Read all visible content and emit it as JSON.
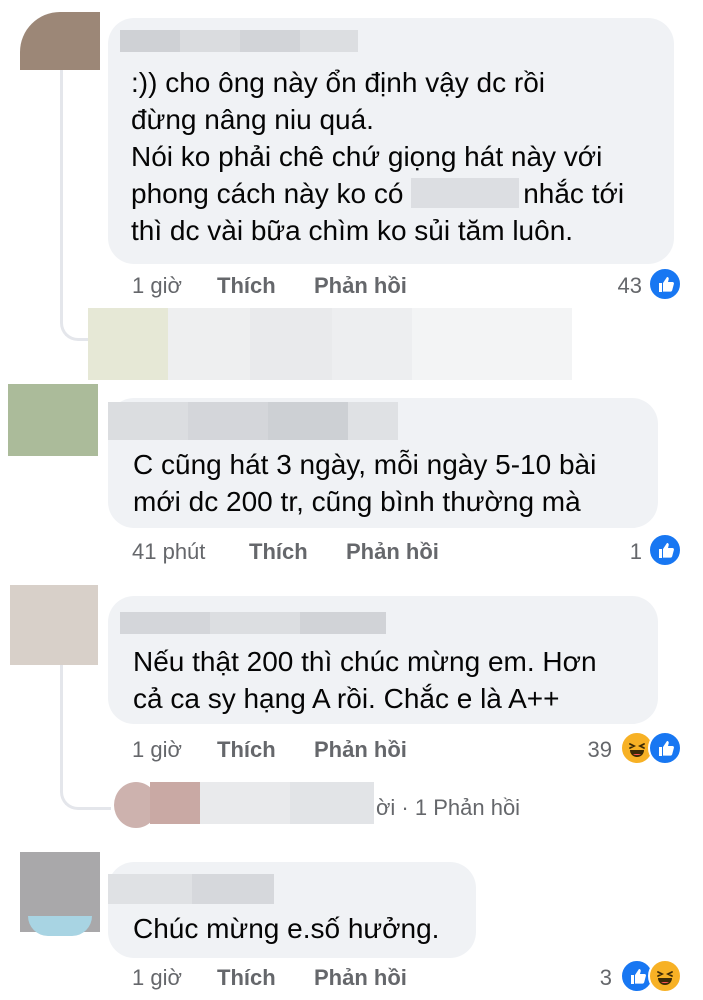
{
  "comments": [
    {
      "lines": [
        ":)) cho ông này ổn định vậy dc rồi",
        "đừng nâng niu quá.",
        "Nói ko phải chê chứ giọng hát này với",
        "phong cách này ko có",
        "nhắc tới",
        "thì dc vài bữa chìm ko sủi tăm luôn."
      ],
      "time": "1 giờ",
      "like": "Thích",
      "reply": "Phản hồi",
      "reactions": "43",
      "reaction_icons": [
        "like-icon"
      ]
    },
    {
      "lines": [
        "C cũng hát 3 ngày, mỗi ngày 5-10 bài",
        "mới dc 200 tr, cũng bình thường mà"
      ],
      "time": "41 phút",
      "like": "Thích",
      "reply": "Phản hồi",
      "reactions": "1",
      "reaction_icons": [
        "like-icon"
      ]
    },
    {
      "lines": [
        "Nếu thật 200 thì chúc mừng em. Hơn",
        "cả ca sy hạng A rồi. Chắc e là A++"
      ],
      "time": "1 giờ",
      "like": "Thích",
      "reply": "Phản hồi",
      "reactions": "39",
      "reaction_icons": [
        "haha-icon",
        "like-icon"
      ],
      "replies_summary": "ời · 1 Phản hồi"
    },
    {
      "lines": [
        "Chúc mừng e.số hưởng."
      ],
      "time": "1 giờ",
      "like": "Thích",
      "reply": "Phản hồi",
      "reactions": "3",
      "reaction_icons": [
        "like-icon",
        "haha-icon"
      ]
    }
  ],
  "colors": {
    "bubble": "#f0f2f5",
    "meta_text": "#65676b",
    "like_blue": "#1877f2",
    "haha_yellow": "#f7b125",
    "thread_line": "#e4e6eb"
  }
}
